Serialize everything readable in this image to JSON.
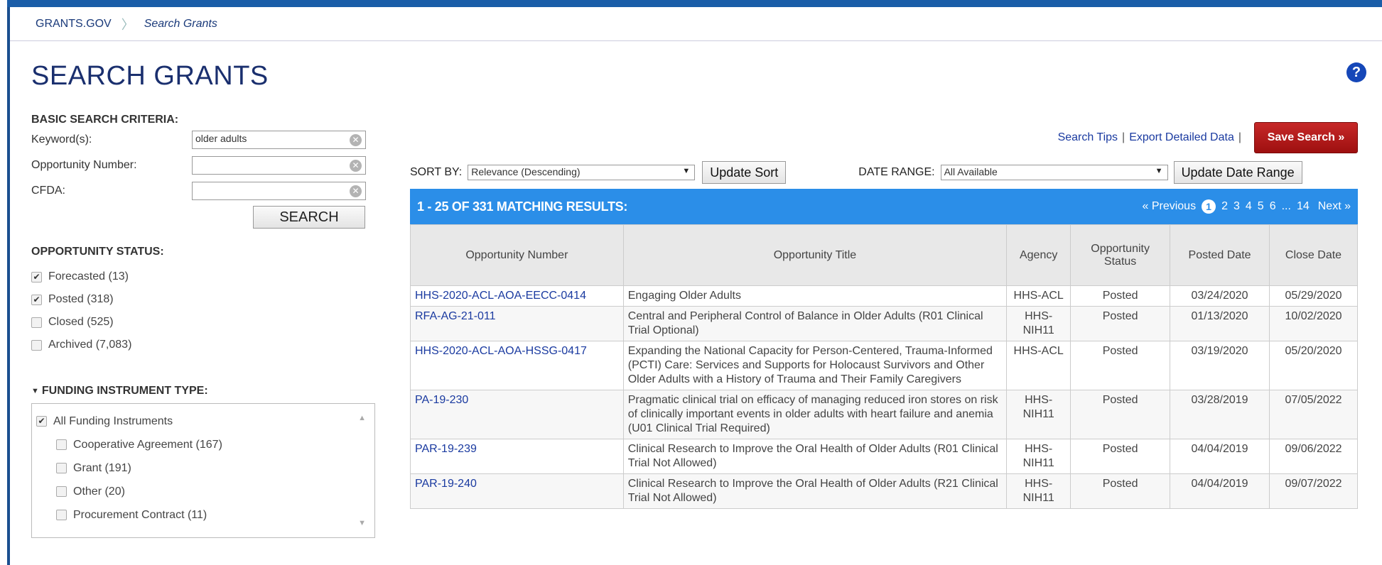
{
  "breadcrumb": {
    "home": "GRANTS.GOV",
    "current": "Search Grants"
  },
  "page": {
    "title": "SEARCH GRANTS",
    "help": "?"
  },
  "basic_search": {
    "heading": "BASIC SEARCH CRITERIA:",
    "keyword_label": "Keyword(s):",
    "keyword_value": "older adults",
    "opportunity_label": "Opportunity Number:",
    "opportunity_value": "",
    "cfda_label": "CFDA:",
    "cfda_value": "",
    "search_button": "SEARCH"
  },
  "status": {
    "heading": "OPPORTUNITY STATUS:",
    "items": [
      {
        "label": "Forecasted",
        "count": "(13)",
        "checked": true
      },
      {
        "label": "Posted",
        "count": "(318)",
        "checked": true
      },
      {
        "label": "Closed",
        "count": "(525)",
        "checked": false
      },
      {
        "label": "Archived",
        "count": "(7,083)",
        "checked": false
      }
    ]
  },
  "funding": {
    "heading": "FUNDING INSTRUMENT TYPE:",
    "all_label": "All Funding Instruments",
    "items": [
      {
        "label": "Cooperative Agreement (167)"
      },
      {
        "label": "Grant (191)"
      },
      {
        "label": "Other (20)"
      },
      {
        "label": "Procurement Contract (11)"
      }
    ]
  },
  "toolbar": {
    "search_tips": "Search Tips",
    "export": "Export Detailed Data",
    "save_search": "Save Search »",
    "sort_label": "SORT BY:",
    "sort_value": "Relevance (Descending)",
    "update_sort": "Update Sort",
    "date_label": "DATE RANGE:",
    "date_value": "All Available",
    "update_date": "Update Date Range"
  },
  "results": {
    "count_text": "1 - 25 OF 331 MATCHING RESULTS:",
    "pager": {
      "prev": "« Previous",
      "current": "1",
      "pages": [
        "2",
        "3",
        "4",
        "5",
        "6"
      ],
      "ellipsis": "...",
      "last": "14",
      "next": "Next »"
    },
    "headers": [
      "Opportunity Number",
      "Opportunity Title",
      "Agency",
      "Opportunity Status",
      "Posted Date",
      "Close Date"
    ],
    "rows": [
      {
        "number": "HHS-2020-ACL-AOA-EECC-0414",
        "title": "Engaging Older Adults",
        "agency": "HHS-ACL",
        "status": "Posted",
        "posted": "03/24/2020",
        "close": "05/29/2020"
      },
      {
        "number": "RFA-AG-21-011",
        "title": "Central and Peripheral Control of Balance in Older Adults (R01 Clinical Trial Optional)",
        "agency": "HHS-NIH11",
        "status": "Posted",
        "posted": "01/13/2020",
        "close": "10/02/2020"
      },
      {
        "number": "HHS-2020-ACL-AOA-HSSG-0417",
        "title": "Expanding the National Capacity for Person-Centered, Trauma-Informed (PCTI) Care: Services and Supports for Holocaust Survivors and Other Older Adults with a History of Trauma and Their Family Caregivers",
        "agency": "HHS-ACL",
        "status": "Posted",
        "posted": "03/19/2020",
        "close": "05/20/2020"
      },
      {
        "number": "PA-19-230",
        "title": "Pragmatic clinical trial on efficacy of managing reduced iron stores on risk of clinically important events in older adults with heart failure and anemia (U01 Clinical Trial Required)",
        "agency": "HHS-NIH11",
        "status": "Posted",
        "posted": "03/28/2019",
        "close": "07/05/2022"
      },
      {
        "number": "PAR-19-239",
        "title": "Clinical Research to Improve the Oral Health of Older Adults (R01 Clinical Trial Not Allowed)",
        "agency": "HHS-NIH11",
        "status": "Posted",
        "posted": "04/04/2019",
        "close": "09/06/2022"
      },
      {
        "number": "PAR-19-240",
        "title": "Clinical Research to Improve the Oral Health of Older Adults (R21 Clinical Trial Not Allowed)",
        "agency": "HHS-NIH11",
        "status": "Posted",
        "posted": "04/04/2019",
        "close": "09/07/2022"
      }
    ]
  }
}
